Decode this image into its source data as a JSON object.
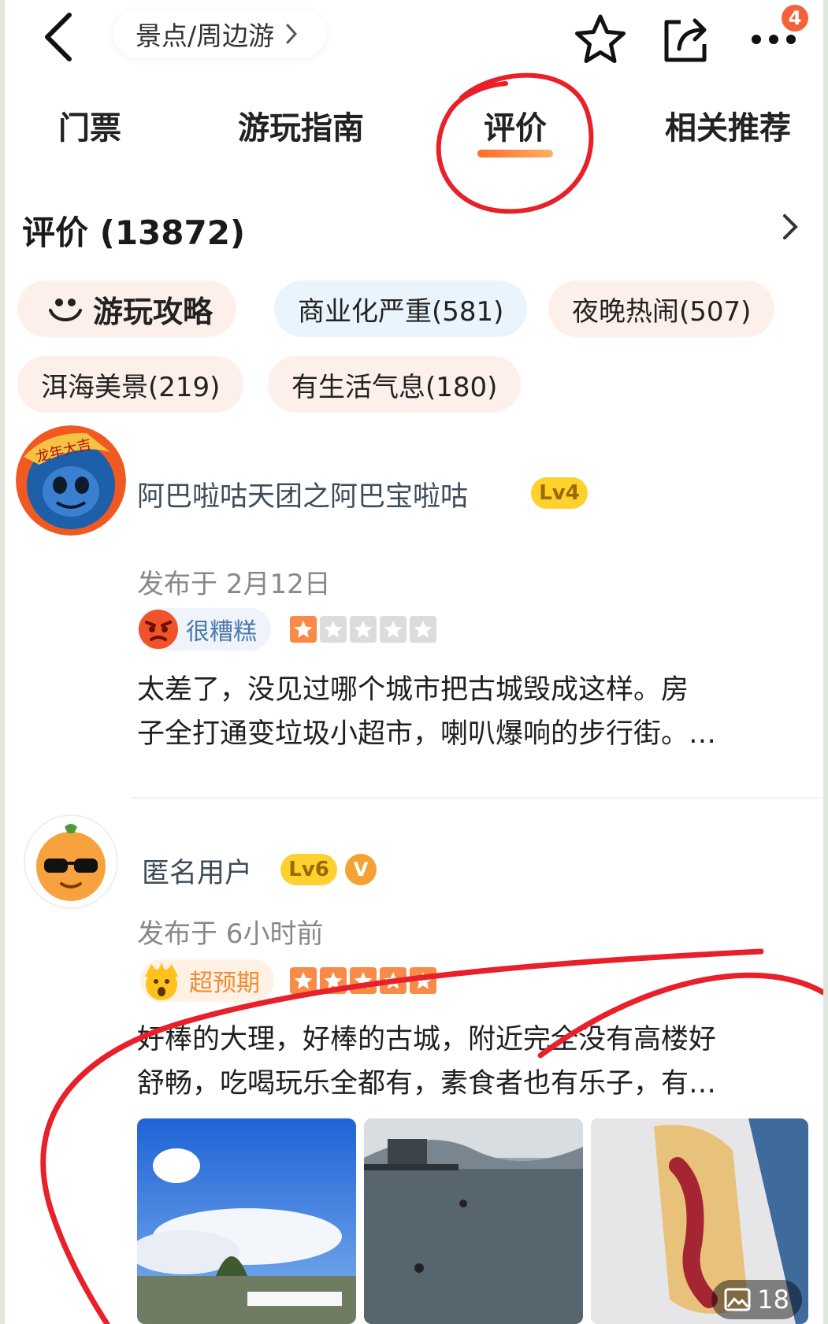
{
  "topbar": {
    "breadcrumb": "景点/周边游",
    "notification_count": "4"
  },
  "tabs": [
    {
      "label": "门票"
    },
    {
      "label": "游玩指南"
    },
    {
      "label": "评价",
      "active": true
    },
    {
      "label": "相关推荐"
    }
  ],
  "reviews_header": {
    "title": "评价 (13872)"
  },
  "tags": [
    {
      "label": "游玩攻略"
    },
    {
      "label": "商业化严重(581)"
    },
    {
      "label": "夜晚热闹(507)"
    },
    {
      "label": "洱海美景(219)"
    },
    {
      "label": "有生活气息(180)"
    }
  ],
  "reviews": [
    {
      "avatar_badge": "龙年大吉",
      "username": "阿巴啦咕天团之阿巴宝啦咕",
      "level": "Lv4",
      "published": "发布于 2月12日",
      "mood": "很糟糕",
      "rating": 1,
      "text_lines": [
        "太差了，没见过哪个城市把古城毁成这样。房",
        "子全打通变垃圾小超市，喇叭爆响的步行街。…"
      ]
    },
    {
      "username": "匿名用户",
      "level": "Lv6",
      "vip": "V",
      "published": "发布于 6小时前",
      "mood": "超预期",
      "rating": 5,
      "text_lines": [
        "好棒的大理，好棒的古城，附近完全没有高楼好",
        "舒畅，吃喝玩乐全都有，素食者也有乐子，有…"
      ],
      "photo_count": "18"
    }
  ],
  "colors": {
    "accent_orange": "#ff6a2b",
    "star_orange": "#f98a48",
    "annotation_red": "#e8202a",
    "level_yellow": "#ffd12e"
  }
}
